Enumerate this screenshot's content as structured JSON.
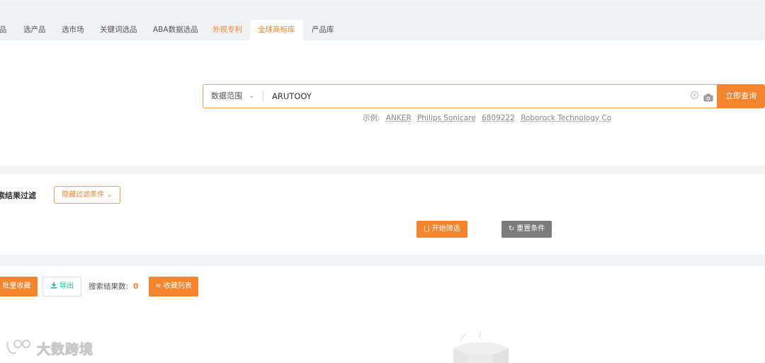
{
  "tabs": [
    {
      "label": "品"
    },
    {
      "label": "选产品"
    },
    {
      "label": "选市场"
    },
    {
      "label": "关键词选品"
    },
    {
      "label": "ABA数据选品"
    },
    {
      "label": "外观专利"
    },
    {
      "label": "全球商标库"
    },
    {
      "label": "产品库"
    }
  ],
  "search": {
    "scope_label": "数据范围",
    "query": "ARUTOOY",
    "button": "立即查询",
    "examples_label": "示例:",
    "examples": [
      "ANKER",
      "Philips Sonicare",
      "6809222",
      "Roborock Technology Co"
    ]
  },
  "filter": {
    "title": "索结果过滤",
    "hide_conditions": "隐藏过滤条件",
    "start": "开始筛选",
    "reset": "重置条件"
  },
  "results": {
    "bulk_collect": "批量收藏",
    "export": "导出",
    "count_label": "搜索结果数:",
    "count": "0",
    "fav_list": "收藏列表"
  },
  "watermark": {
    "text": "大数跨境"
  },
  "colors": {
    "accent": "#f5842c",
    "export": "#1abc9c",
    "reset": "#7b7b7b"
  }
}
